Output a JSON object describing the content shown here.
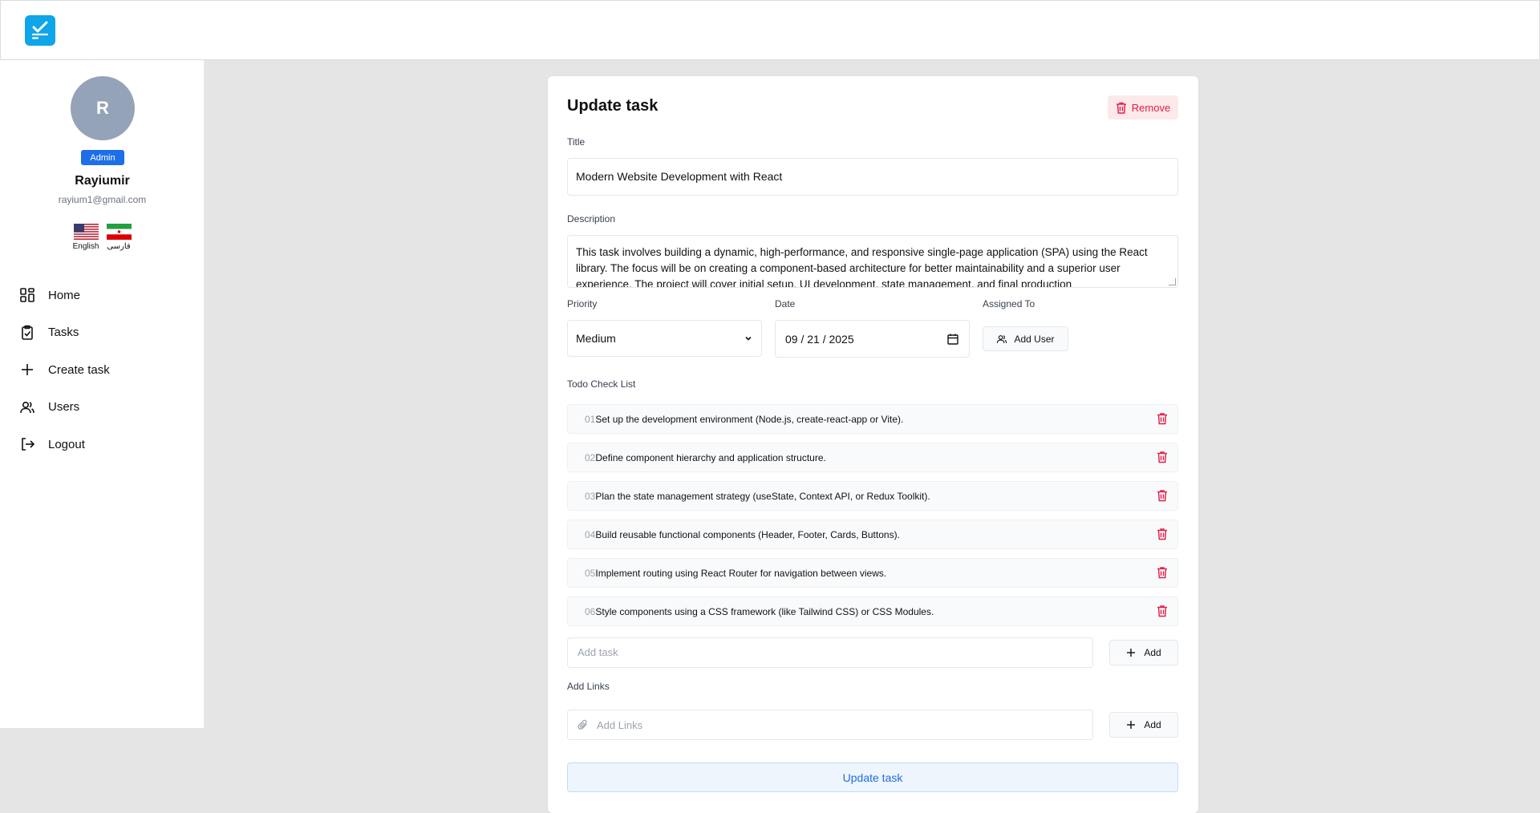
{
  "header": {
    "logo_icon": "checklist-logo-icon",
    "accent": "#0ea5e9"
  },
  "sidebar": {
    "avatar_initial": "R",
    "role": "Admin",
    "name": "Rayiumir",
    "email": "rayium1@gmail.com",
    "languages": [
      {
        "label": "English",
        "icon": "us-flag-icon"
      },
      {
        "label": "فارسی",
        "icon": "iran-flag-icon"
      }
    ],
    "nav": [
      {
        "label": "Home",
        "icon": "grid-icon"
      },
      {
        "label": "Tasks",
        "icon": "clipboard-check-icon"
      },
      {
        "label": "Create task",
        "icon": "plus-icon"
      },
      {
        "label": "Users",
        "icon": "users-icon"
      },
      {
        "label": "Logout",
        "icon": "logout-icon"
      }
    ]
  },
  "form": {
    "heading": "Update task",
    "remove_label": "Remove",
    "title_label": "Title",
    "title_value": "Modern Website Development with React",
    "description_label": "Description",
    "description_value": "This task involves building a dynamic, high-performance, and responsive single-page application (SPA) using the React library. The focus will be on creating a component-based architecture for better maintainability and a superior user experience. The project will cover initial setup, UI development, state management, and final production",
    "priority_label": "Priority",
    "priority_value": "Medium",
    "date_label": "Date",
    "date_value": "09 / 21 / 2025",
    "assigned_label": "Assigned To",
    "add_user_label": "Add User",
    "checklist_label": "Todo Check List",
    "checklist": [
      {
        "num": "01",
        "text": "Set up the development environment (Node.js, create-react-app or Vite)."
      },
      {
        "num": "02",
        "text": "Define component hierarchy and application structure."
      },
      {
        "num": "03",
        "text": "Plan the state management strategy (useState, Context API, or Redux Toolkit)."
      },
      {
        "num": "04",
        "text": "Build reusable functional components (Header, Footer, Cards, Buttons)."
      },
      {
        "num": "05",
        "text": "Implement routing using React Router for navigation between views."
      },
      {
        "num": "06",
        "text": "Style components using a CSS framework (like Tailwind CSS) or CSS Modules."
      }
    ],
    "add_task_placeholder": "Add task",
    "add_label": "Add",
    "links_label": "Add Links",
    "links_placeholder": "Add Links",
    "submit_label": "Update task"
  }
}
